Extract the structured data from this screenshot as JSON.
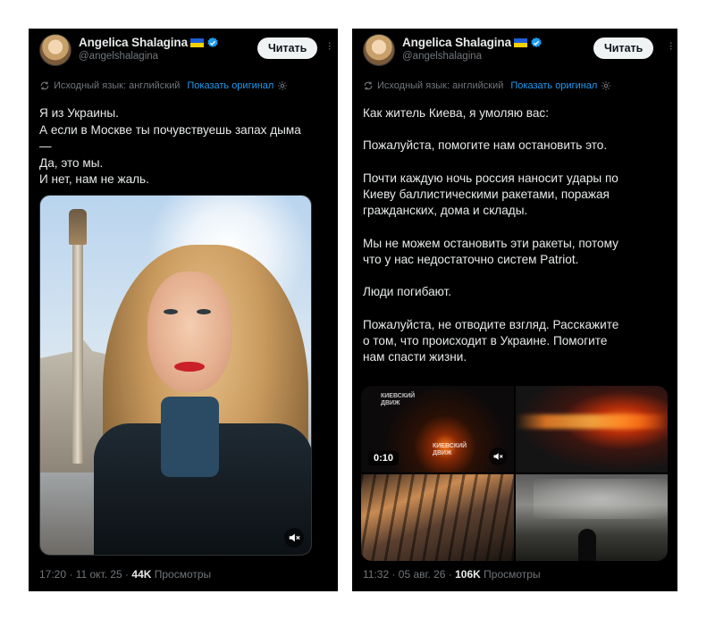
{
  "left_post": {
    "display_name": "Angelica Shalagina",
    "handle": "@angelshalagina",
    "follow_label": "Читать",
    "translation_note": "Исходный язык: английский",
    "show_original_label": "Показать оригинал",
    "text": "Я из Украины.\nА если в Москве ты почувствуешь запах дыма\n—\nДа, это мы.\nИ нет, нам не жаль.",
    "meta_time_date": "17:20 · 11 окт. 25 · ",
    "views_count": "44K",
    "views_label": " Просмотры"
  },
  "right_post": {
    "display_name": "Angelica Shalagina",
    "handle": "@angelshalagina",
    "follow_label": "Читать",
    "translation_note": "Исходный язык: английский",
    "show_original_label": "Показать оригинал",
    "text": "Как житель Киева, я умоляю вас:\n\nПожалуйста, помогите нам остановить это.\n\nПочти каждую ночь россия наносит удары по\nКиеву баллистическими ракетами, поражая\nгражданских, дома и склады.\n\nМы не можем остановить эти ракеты, потому\nчто у нас недостаточно систем Patriot.\n\nЛюди погибают.\n\nПожалуйста, не отводите взгляд. Расскажите\nо том, что происходит в Украине. Помогите\nнам спасти жизни.",
    "video_duration": "0:10",
    "watermark_1": "КИЕВСКИЙ\nДВИЖ",
    "watermark_2": "КИЕВСКИЙ\nДВИЖ",
    "meta_time_date": "11:32 · 05 авг. 26 · ",
    "views_count": "106K",
    "views_label": " Просмотры"
  },
  "colors": {
    "background": "#000000",
    "text": "#e7e9ea",
    "muted": "#71767b",
    "link": "#1d9bf0",
    "verified": "#1d9bf0",
    "flag_blue": "#1e5fd6",
    "flag_yellow": "#f5d000",
    "button_bg": "#eff3f4"
  },
  "icons": {
    "verified": "verified-badge-icon",
    "translate": "translate-icon",
    "settings": "gear-icon",
    "mute": "speaker-muted-icon",
    "more": "more-dots-icon"
  }
}
